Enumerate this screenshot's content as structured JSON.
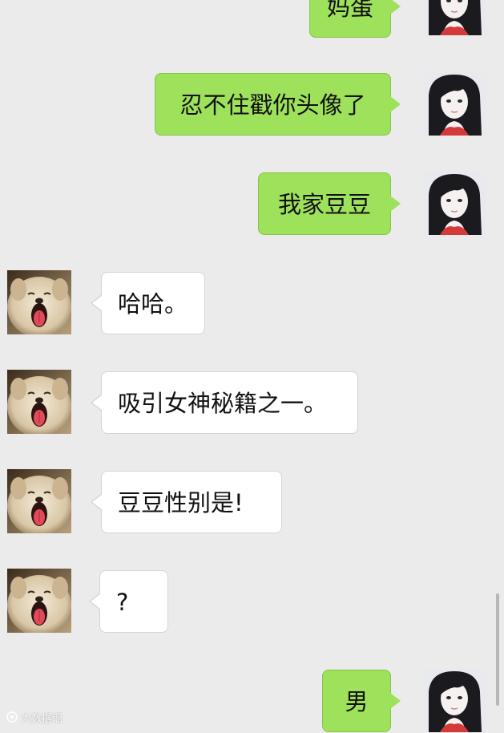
{
  "messages": [
    {
      "id": "m1",
      "side": "right",
      "text": "妈蛋"
    },
    {
      "id": "m2",
      "side": "right",
      "text": "忍不住戳你头像了"
    },
    {
      "id": "m3",
      "side": "right",
      "text": "我家豆豆"
    },
    {
      "id": "m4",
      "side": "left",
      "text": "哈哈。"
    },
    {
      "id": "m5",
      "side": "left",
      "text": "吸引女神秘籍之一。"
    },
    {
      "id": "m6",
      "side": "left",
      "text": "豆豆性别是!"
    },
    {
      "id": "m7",
      "side": "left",
      "text": "?"
    },
    {
      "id": "m8",
      "side": "right",
      "text": "男"
    }
  ],
  "avatars": {
    "self": "girl-avatar",
    "other": "dog-avatar"
  },
  "colors": {
    "background": "#ebebeb",
    "outgoing_bubble": "#9ee15a",
    "incoming_bubble": "#ffffff"
  },
  "watermark": {
    "icon": "watermark-logo-icon",
    "text": "大数据谣"
  }
}
